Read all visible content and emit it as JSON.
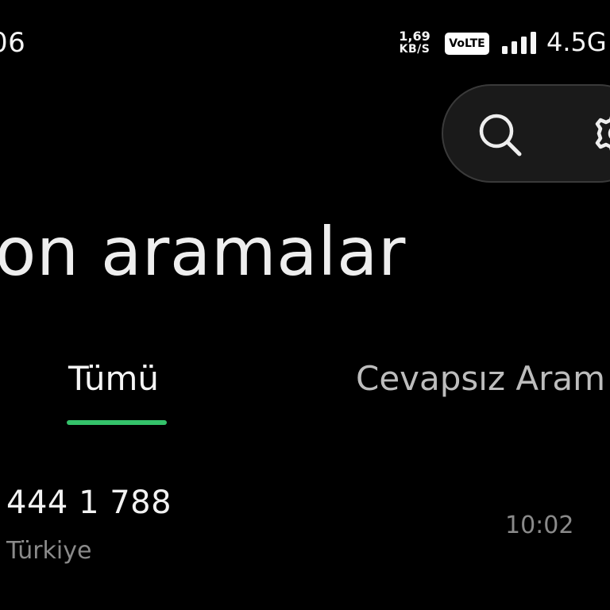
{
  "status_bar": {
    "time": "06",
    "net_speed_value": "1,69",
    "net_speed_unit": "KB/S",
    "volte": "VoLTE",
    "network_type": "4.5G",
    "signal_level": 4
  },
  "header": {
    "title": "on aramalar"
  },
  "tabs": [
    {
      "label": "Tümü",
      "active": true
    },
    {
      "label": "Cevapsız Aram",
      "active": false
    }
  ],
  "call_log": [
    {
      "number": "444 1 788",
      "location": "Türkiye",
      "time": "10:02"
    }
  ],
  "colors": {
    "background": "#000000",
    "accent": "#34c26a",
    "text_primary": "#f2f2f2",
    "text_secondary": "#8a8a8a",
    "pill_background": "#1a1a1a"
  },
  "icons": [
    "search-icon",
    "gear-icon",
    "signal-icon"
  ]
}
